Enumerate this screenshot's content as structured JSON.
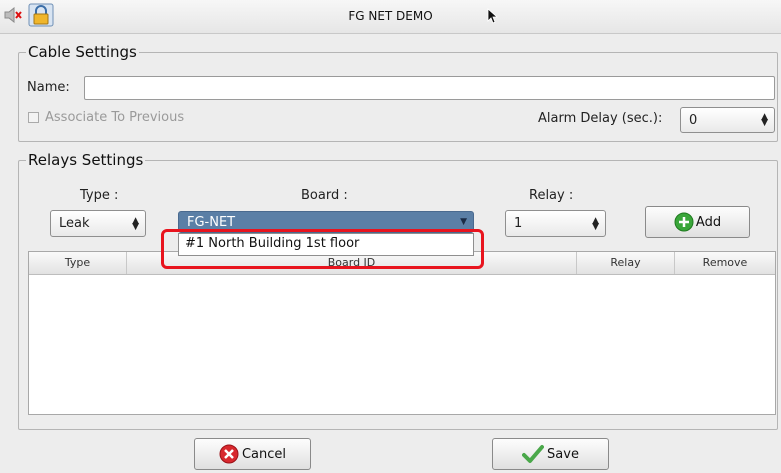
{
  "window": {
    "title": "FG NET DEMO"
  },
  "cable_settings": {
    "legend": "Cable Settings",
    "name_label": "Name:",
    "name_value": "",
    "associate_label": "Associate To Previous",
    "associate_checked": false,
    "alarm_delay_label": "Alarm Delay (sec.):",
    "alarm_delay_value": "0"
  },
  "relays_settings": {
    "legend": "Relays Settings",
    "type_label": "Type :",
    "board_label": "Board :",
    "relay_label": "Relay :",
    "type_value": "Leak",
    "board_value": "FG-NET",
    "relay_value": "1",
    "add_label": "Add",
    "board_options": [
      "#1 North Building 1st floor"
    ],
    "table_columns": [
      "Type",
      "Board ID",
      "Relay",
      "Remove"
    ],
    "table_rows": []
  },
  "footer": {
    "cancel_label": "Cancel",
    "save_label": "Save"
  },
  "colors": {
    "accent_select": "#5b7fa6",
    "highlight": "#e8141e",
    "add_green": "#3aa63a",
    "cancel_red": "#d8282e"
  },
  "icons": [
    "speaker-muted-icon",
    "lock-icon",
    "cursor-arrow-icon",
    "plus-circle-icon",
    "x-circle-icon",
    "checkmark-icon"
  ]
}
